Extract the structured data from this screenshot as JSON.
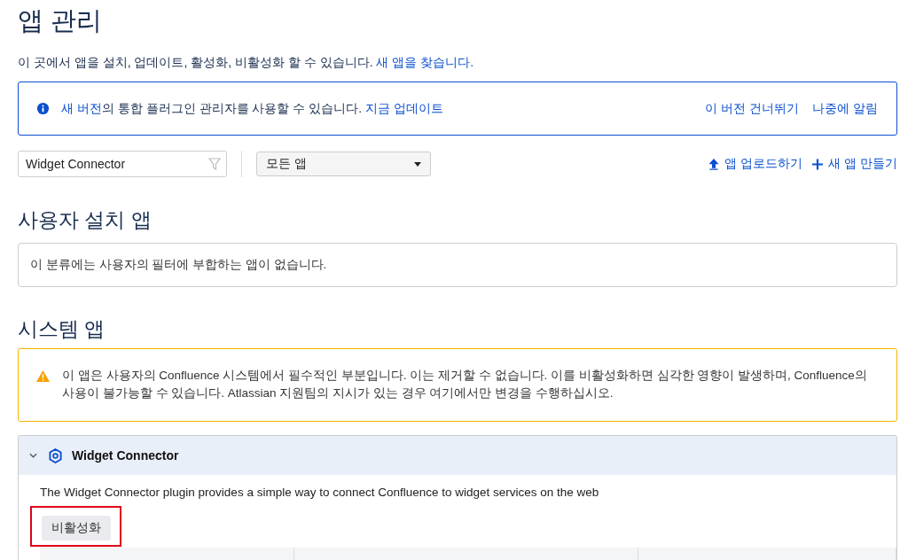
{
  "page_title": "앱 관리",
  "intro": {
    "text": "이 곳에서 앱을 설치, 업데이트, 활성화, 비활성화 할 수 있습니다.",
    "link": "새 앱을 찾습니다."
  },
  "update_notice": {
    "parts": [
      {
        "kind": "link",
        "text": "새 버전"
      },
      {
        "kind": "text",
        "text": "의 통합 플러그인 관리자를 사용할 수 있습니다."
      },
      {
        "kind": "link",
        "text": "지금 업데이트"
      }
    ],
    "actions": [
      "이 버전 건너뛰기",
      "나중에 알림"
    ]
  },
  "filter": {
    "search_value": "Widget Connector",
    "dropdown": "모든 앱",
    "actions": [
      {
        "kind": "upload",
        "label": "앱 업로드하기"
      },
      {
        "kind": "create",
        "label": "새 앱 만들기"
      }
    ]
  },
  "user_apps": {
    "heading": "사용자 설치 앱",
    "empty_message": "이 분류에는 사용자의 필터에 부합하는 앱이 없습니다."
  },
  "system_apps": {
    "heading": "시스템 앱",
    "warning": "이 앱은 사용자의 Confluence 시스템에서 필수적인 부분입니다. 이는 제거할 수 없습니다. 이를 비활성화하면 심각한 영향이 발생하며, Confluence의 사용이 불가능할 수 있습니다. Atlassian 지원팀의 지시가 있는 경우 여기에서만 변경을 수행하십시오.",
    "apps": [
      {
        "name": "Widget Connector",
        "expanded": true,
        "description": "The Widget Connector plugin provides a simple way to connect Confluence to widget services on the web",
        "button": "비활성화",
        "highlighted": true
      }
    ]
  }
}
